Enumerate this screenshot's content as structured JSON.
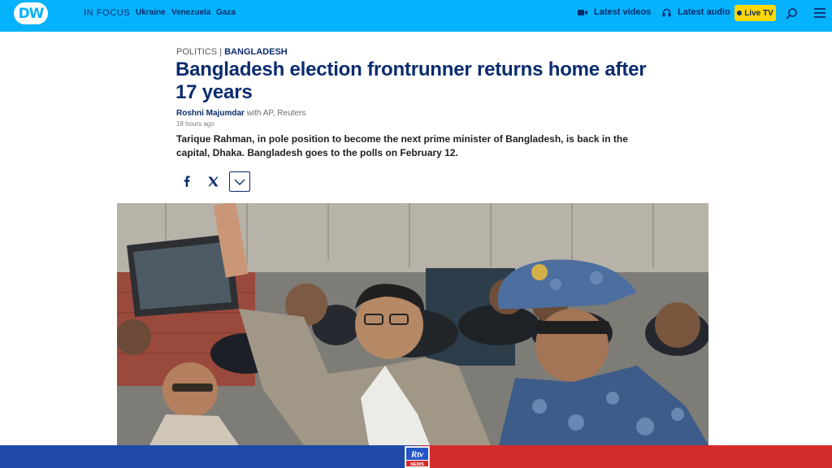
{
  "header": {
    "logo_text": "DW",
    "in_focus_label": "IN FOCUS",
    "topics": [
      "Ukraine",
      "Venezuela",
      "Gaza"
    ],
    "latest_videos_label": "Latest videos",
    "latest_audio_label": "Latest audio",
    "live_tv_label": "Live TV",
    "bar_color": "#05b2fc",
    "text_color": "#0b2c6e",
    "live_tv_color": "#ffd800"
  },
  "article": {
    "category_prefix": "POLITICS",
    "category_separator": "|",
    "category": "BANGLADESH",
    "title": "Bangladesh election frontrunner returns home after 17 years",
    "author": "Roshni Majumdar",
    "contributors": "with AP, Reuters",
    "timestamp": "18 hours ago",
    "teaser": "Tarique Rahman, in pole position to become the next prime minister of Bangladesh, is back in the capital, Dhaka. Bangladesh goes to the polls on February 12."
  },
  "share": {
    "icons": [
      "facebook-icon",
      "x-icon",
      "chevron-down-icon"
    ]
  },
  "banner": {
    "logo_text_top": "Rtv",
    "logo_text_bottom": "NEWS",
    "left_color": "#1f4aa8",
    "right_color": "#d42b2b"
  }
}
